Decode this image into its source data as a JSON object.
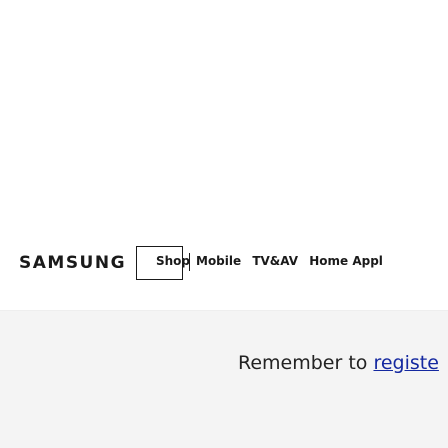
{
  "header": {
    "logo_text": "SAMSUNG",
    "shop_label": "Shop",
    "nav_items": [
      "Mobile",
      "TV&AV",
      "Home Appl"
    ]
  },
  "notice": {
    "text_prefix": "Remember to ",
    "link_text": "registe"
  },
  "colors": {
    "link": "#1428a0",
    "notice_bg": "#f4f4f4",
    "text": "#1a1a1a"
  }
}
